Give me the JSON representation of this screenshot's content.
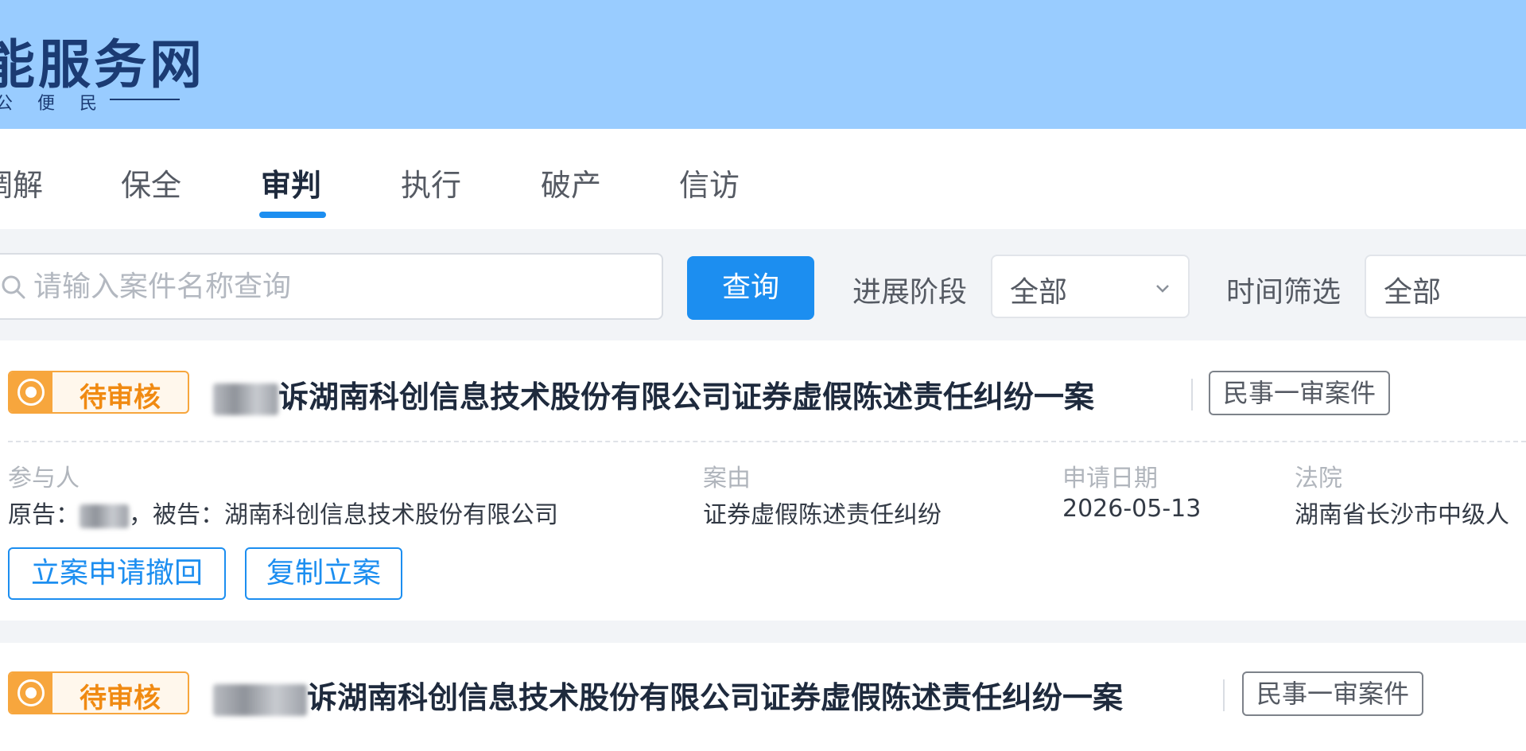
{
  "header": {
    "title": "能服务网",
    "subtitle": "公 便 民"
  },
  "tabs": [
    {
      "label": "调解",
      "active": false
    },
    {
      "label": "保全",
      "active": false
    },
    {
      "label": "审判",
      "active": true
    },
    {
      "label": "执行",
      "active": false
    },
    {
      "label": "破产",
      "active": false
    },
    {
      "label": "信访",
      "active": false
    }
  ],
  "filter": {
    "search_placeholder": "请输入案件名称查询",
    "query_label": "查询",
    "stage_label": "进展阶段",
    "stage_value": "全部",
    "time_label": "时间筛选",
    "time_value": "全部"
  },
  "columns": {
    "parties": "参与人",
    "cause": "案由",
    "date": "申请日期",
    "court": "法院"
  },
  "cases": [
    {
      "status": "待审核",
      "title": "诉湖南科创信息技术股份有限公司证券虚假陈述责任纠纷一案",
      "type": "民事一审案件",
      "plaintiff_label": "原告：",
      "defendant_text": "，被告：湖南科创信息技术股份有限公司",
      "cause": "证券虚假陈述责任纠纷",
      "date": "2026-05-13",
      "court": "湖南省长沙市中级人",
      "actions": [
        "立案申请撤回",
        "复制立案"
      ]
    },
    {
      "status": "待审核",
      "title": "诉湖南科创信息技术股份有限公司证券虚假陈述责任纠纷一案",
      "type": "民事一审案件"
    }
  ],
  "colors": {
    "header_bg": "#99ccff",
    "primary": "#1c8ef0",
    "status_orange": "#f7a63d",
    "brand_text": "#1b3b73"
  }
}
